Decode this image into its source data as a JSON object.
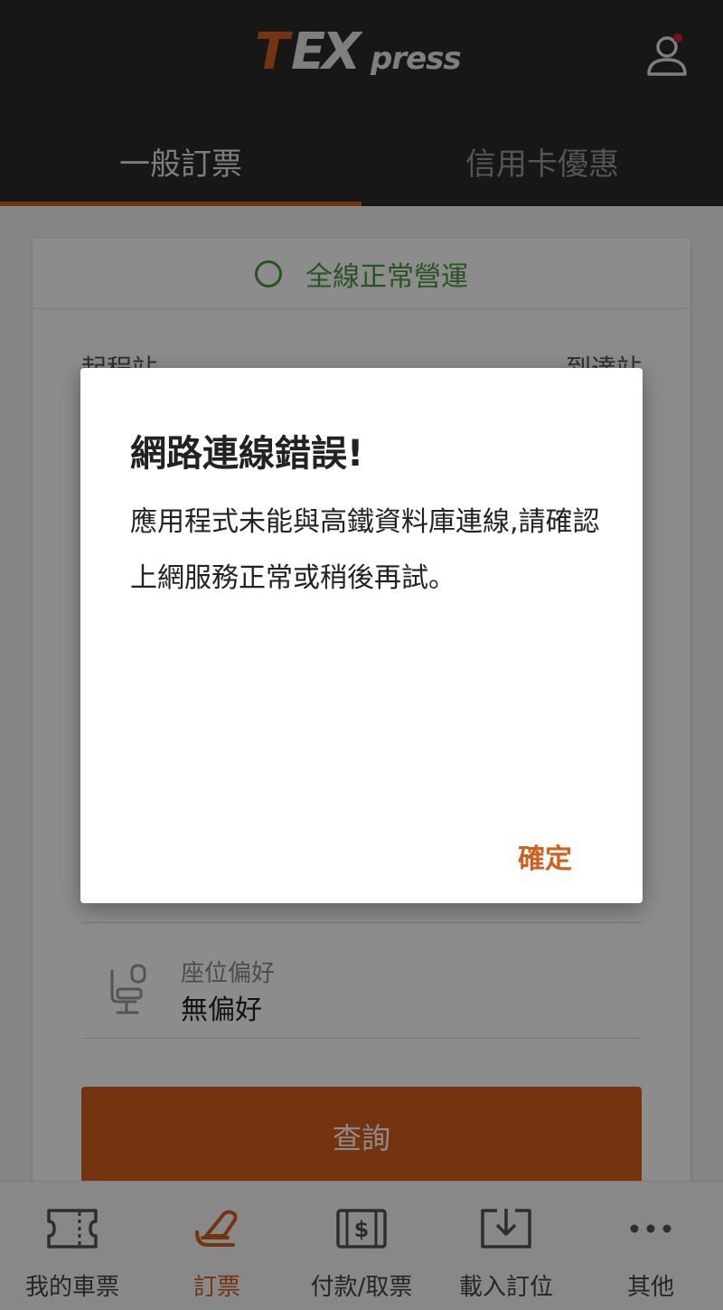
{
  "app": {
    "logo": {
      "t": "T",
      "ex": "EX",
      "press": "press"
    }
  },
  "tabs": [
    {
      "label": "一般訂票",
      "active": true
    },
    {
      "label": "信用卡優惠",
      "active": false
    }
  ],
  "status": {
    "text": "全線正常營運",
    "color": "#4a9a3a"
  },
  "form": {
    "from_label": "起程站",
    "to_label": "到達站",
    "seat_label": "座位偏好",
    "seat_value": "無偏好",
    "query_button": "查詢"
  },
  "bottom_nav": [
    {
      "label": "我的車票",
      "icon": "ticket-icon",
      "active": false
    },
    {
      "label": "訂票",
      "icon": "seat-icon",
      "active": true
    },
    {
      "label": "付款/取票",
      "icon": "payment-icon",
      "active": false
    },
    {
      "label": "載入訂位",
      "icon": "download-icon",
      "active": false
    },
    {
      "label": "其他",
      "icon": "more-icon",
      "active": false
    }
  ],
  "dialog": {
    "title": "網路連線錯誤!",
    "message": "應用程式未能與高鐵資料庫連線,請確認上網服務正常或稍後再試。",
    "ok_label": "確定"
  },
  "colors": {
    "accent": "#d2601c",
    "header_bg": "#2a2a2c",
    "status_green": "#4a9a3a",
    "notification_dot": "#c62828"
  }
}
